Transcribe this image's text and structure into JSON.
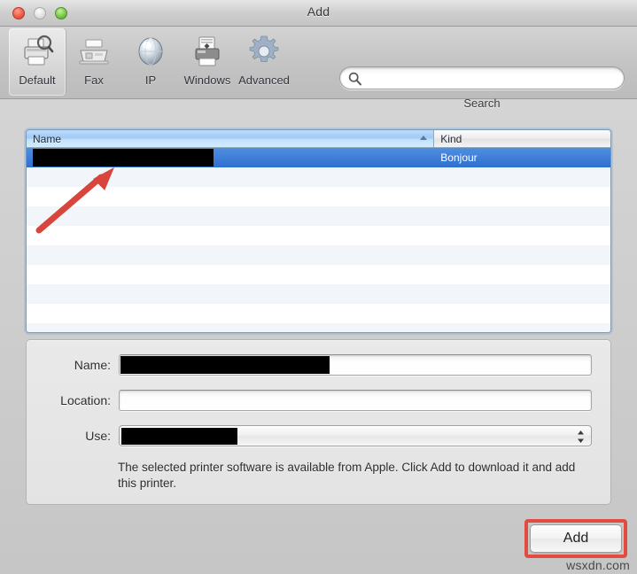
{
  "window": {
    "title": "Add",
    "traffic_lights": [
      {
        "name": "close",
        "color": "#f0624d",
        "enabled": true
      },
      {
        "name": "minimize",
        "color": "#e2e2e2",
        "enabled": false
      },
      {
        "name": "zoom",
        "color": "#7fca4e",
        "enabled": true
      }
    ]
  },
  "toolbar": {
    "items": [
      {
        "label": "Default",
        "icon": "default-printer-icon",
        "selected": true
      },
      {
        "label": "Fax",
        "icon": "fax-icon",
        "selected": false
      },
      {
        "label": "IP",
        "icon": "globe-icon",
        "selected": false
      },
      {
        "label": "Windows",
        "icon": "windows-printer-icon",
        "selected": false
      },
      {
        "label": "Advanced",
        "icon": "gear-icon",
        "selected": false
      }
    ]
  },
  "search": {
    "value": "",
    "placeholder": "",
    "caption": "Search",
    "icon": "search-icon"
  },
  "printer_list": {
    "columns": [
      {
        "label": "Name",
        "sorted": true,
        "sort_direction": "ascending"
      },
      {
        "label": "Kind",
        "sorted": false,
        "sort_direction": ""
      }
    ],
    "rows": [
      {
        "name": "",
        "name_redacted": true,
        "kind": "Bonjour",
        "selected": true
      }
    ],
    "empty_row_count": 9
  },
  "form": {
    "name": {
      "label": "Name:",
      "value": "",
      "redacted": true
    },
    "location": {
      "label": "Location:",
      "value": "",
      "redacted": false
    },
    "use": {
      "label": "Use:",
      "value": "",
      "redacted": true
    },
    "help_text": "The selected printer software is available from Apple. Click Add to download it and add this printer."
  },
  "actions": {
    "add_label": "Add"
  },
  "annotations": {
    "arrow_color": "#d8453c",
    "highlight_color": "#e24a42",
    "arrow_target": "selected-printer-row",
    "highlight_target": "add-button"
  },
  "watermark": {
    "text": "wsxdn.com"
  },
  "colors": {
    "selection_blue": "#3a7bd5",
    "header_blue": "#9fcaf6",
    "window_gray": "#c6c6c6"
  }
}
